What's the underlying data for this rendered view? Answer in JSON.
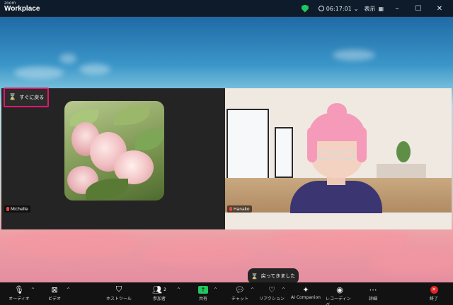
{
  "app": {
    "brand_small": "zoom",
    "brand_name": "Workplace"
  },
  "titlebar": {
    "timer": "06:17:01",
    "view_label": "表示",
    "grid_icon": "grid-icon"
  },
  "participants": [
    {
      "name": "Michelle"
    },
    {
      "name": "Hanako"
    }
  ],
  "return_button": {
    "label": "すぐに戻る"
  },
  "toast": {
    "label": "戻ってきました"
  },
  "toolbar": {
    "audio": "オーディオ",
    "video": "ビデオ",
    "host_tools": "ホストツール",
    "participants": "参加者",
    "participants_count": "2",
    "share": "共有",
    "chat": "チャット",
    "reactions": "リアクション",
    "ai": "AI Companion",
    "record": "レコーディング",
    "more": "詳細",
    "end": "終了"
  },
  "colors": {
    "accent_green": "#22c55e",
    "end_red": "#e02424",
    "highlight": "#e3166f"
  }
}
